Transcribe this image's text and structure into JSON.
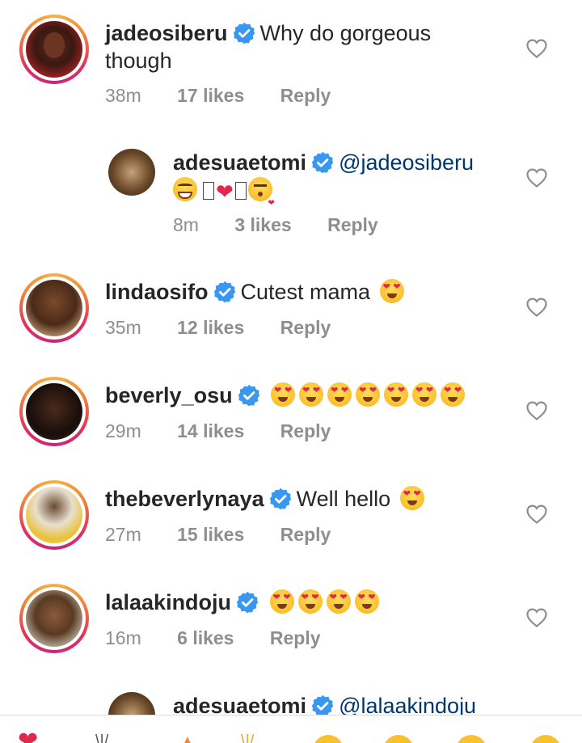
{
  "comments": [
    {
      "username": "jadeosiberu",
      "text_line1": "Why do gorgeous",
      "text_line2": "though",
      "time": "38m",
      "likes": "17 likes",
      "reply": "Reply"
    },
    {
      "username": "adesuaetomi",
      "mention": "@jadeosiberu",
      "time": "8m",
      "likes": "3 likes",
      "reply": "Reply"
    },
    {
      "username": "lindaosifo",
      "text": "Cutest mama",
      "time": "35m",
      "likes": "12 likes",
      "reply": "Reply"
    },
    {
      "username": "beverly_osu",
      "time": "29m",
      "likes": "14 likes",
      "reply": "Reply"
    },
    {
      "username": "thebeverlynaya",
      "text": "Well hello",
      "time": "27m",
      "likes": "15 likes",
      "reply": "Reply"
    },
    {
      "username": "lalaakindoju",
      "time": "16m",
      "likes": "6 likes",
      "reply": "Reply"
    },
    {
      "username": "adesuaetomi",
      "mention": "@lalaakindoju"
    }
  ],
  "colors": {
    "verified": "#3897f0",
    "mention": "#00376b",
    "meta": "#8e8e8e",
    "ring_start": "#f5b045",
    "ring_end": "#c4287d"
  }
}
